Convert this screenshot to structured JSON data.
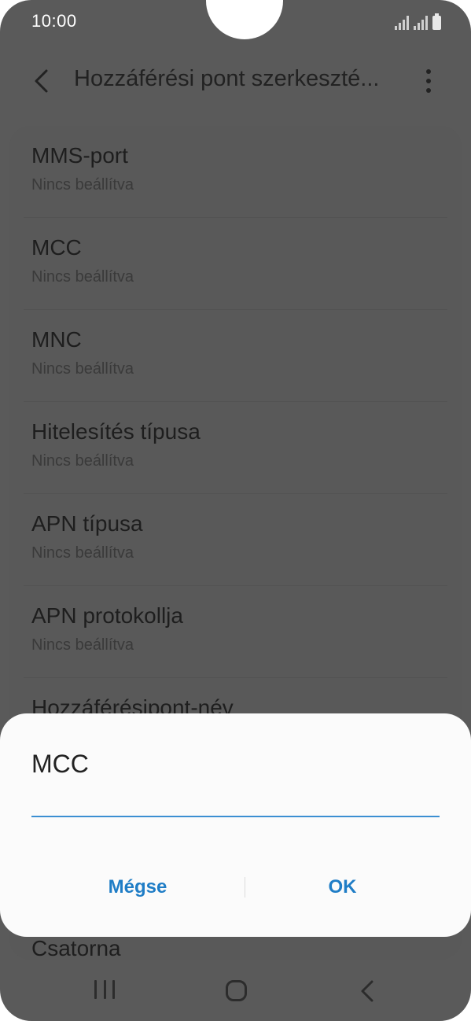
{
  "status_bar": {
    "time": "10:00"
  },
  "header": {
    "title": "Hozzáférési pont szerkeszté..."
  },
  "settings_list": {
    "items": [
      {
        "title": "MMS-port",
        "value": "Nincs beállítva"
      },
      {
        "title": "MCC",
        "value": "Nincs beállítva"
      },
      {
        "title": "MNC",
        "value": "Nincs beállítva"
      },
      {
        "title": "Hitelesítés típusa",
        "value": "Nincs beállítva"
      },
      {
        "title": "APN típusa",
        "value": "Nincs beállítva"
      },
      {
        "title": "APN protokollja",
        "value": "Nincs beállítva"
      },
      {
        "title": "Hozzáférésipont-név"
      }
    ],
    "bottom_item": "Csatorna"
  },
  "dialog": {
    "title": "MCC",
    "input_value": "",
    "cancel_label": "Mégse",
    "ok_label": "OK"
  },
  "colors": {
    "accent": "#1f7dc6",
    "scrim": "#5a5a5a",
    "dialog_background": "#fbfbfb"
  },
  "icons": {
    "back": "back-arrow-icon",
    "more": "more-vertical-icon",
    "nav_recents": "recents-icon",
    "nav_home": "home-icon",
    "nav_back": "nav-back-icon"
  }
}
